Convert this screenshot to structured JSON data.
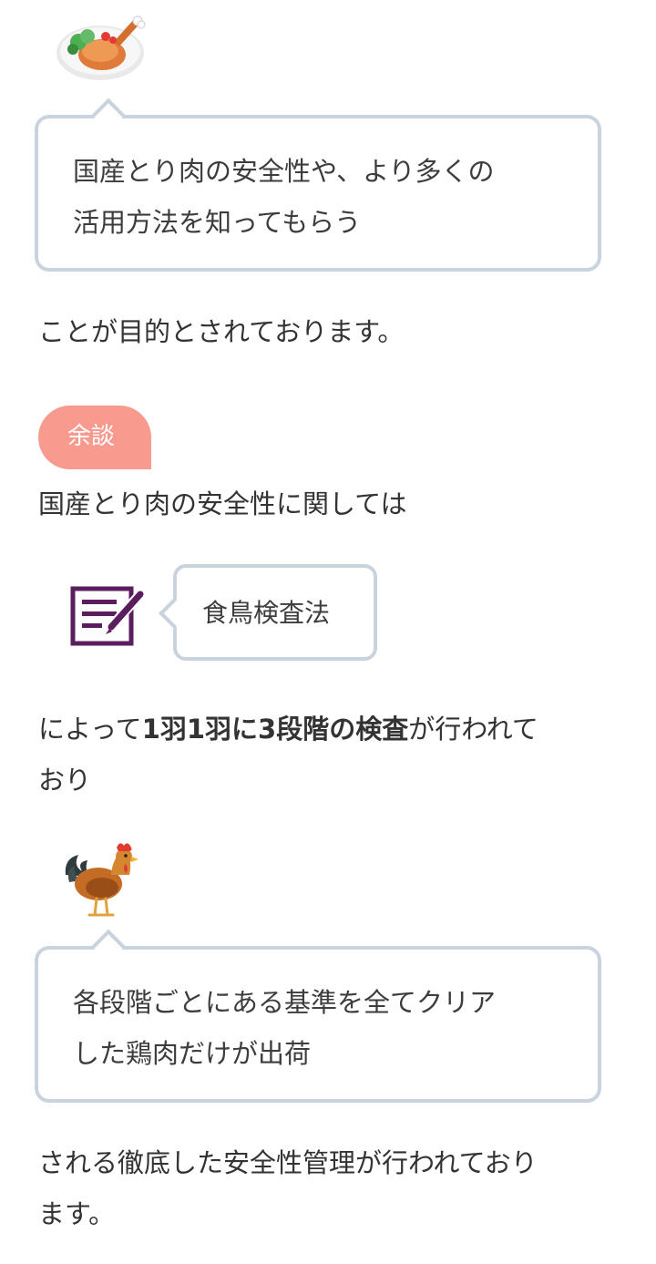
{
  "bubbles": {
    "first": {
      "avatar_icon": "roast-chicken-plate-icon",
      "line1": "国産とり肉の安全性や、より多くの",
      "line2": "活用方法を知ってもらう"
    },
    "second": {
      "avatar_icon": "rooster-icon",
      "line1": "各段階ごとにある基準を全てクリア",
      "line2": "した鶏肉だけが出荷"
    }
  },
  "paragraphs": {
    "p1": "ことが目的とされております。",
    "p2": "国産とり肉の安全性に関しては",
    "p3": {
      "prefix": "によって",
      "bold": "1羽1羽に3段階の検査",
      "suffix": "が行われて",
      "line2": "おり"
    },
    "p4": {
      "line1": "される徹底した安全性管理が行われており",
      "line2": "ます。"
    }
  },
  "aside": {
    "label": "余談",
    "color": "#f99a8f"
  },
  "side_note": {
    "icon": "notebook-pen-icon",
    "text": "食鳥検査法"
  },
  "colors": {
    "bubble_border": "#c9d3dd",
    "notebook_icon": "#5a1d5e",
    "text": "#333333"
  }
}
